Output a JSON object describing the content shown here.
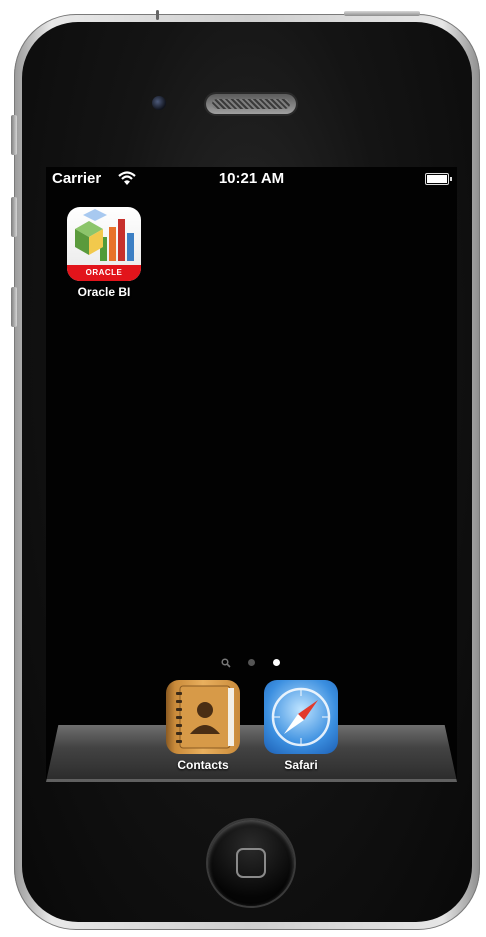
{
  "status_bar": {
    "carrier": "Carrier",
    "time": "10:21 AM",
    "wifi_icon": "wifi-icon",
    "battery_icon": "battery-icon"
  },
  "home_screen": {
    "apps": [
      {
        "label": "Oracle BI",
        "icon": "oracle-bi-icon",
        "brand_text": "ORACLE",
        "brand_color": "#e2141b"
      }
    ]
  },
  "page_indicator": {
    "pages": 2,
    "current": 2,
    "search_icon": "search-icon"
  },
  "dock": {
    "apps": [
      {
        "label": "Contacts",
        "icon": "contacts-icon"
      },
      {
        "label": "Safari",
        "icon": "safari-icon"
      }
    ]
  },
  "hardware": {
    "home_button_icon": "home-button-icon"
  }
}
